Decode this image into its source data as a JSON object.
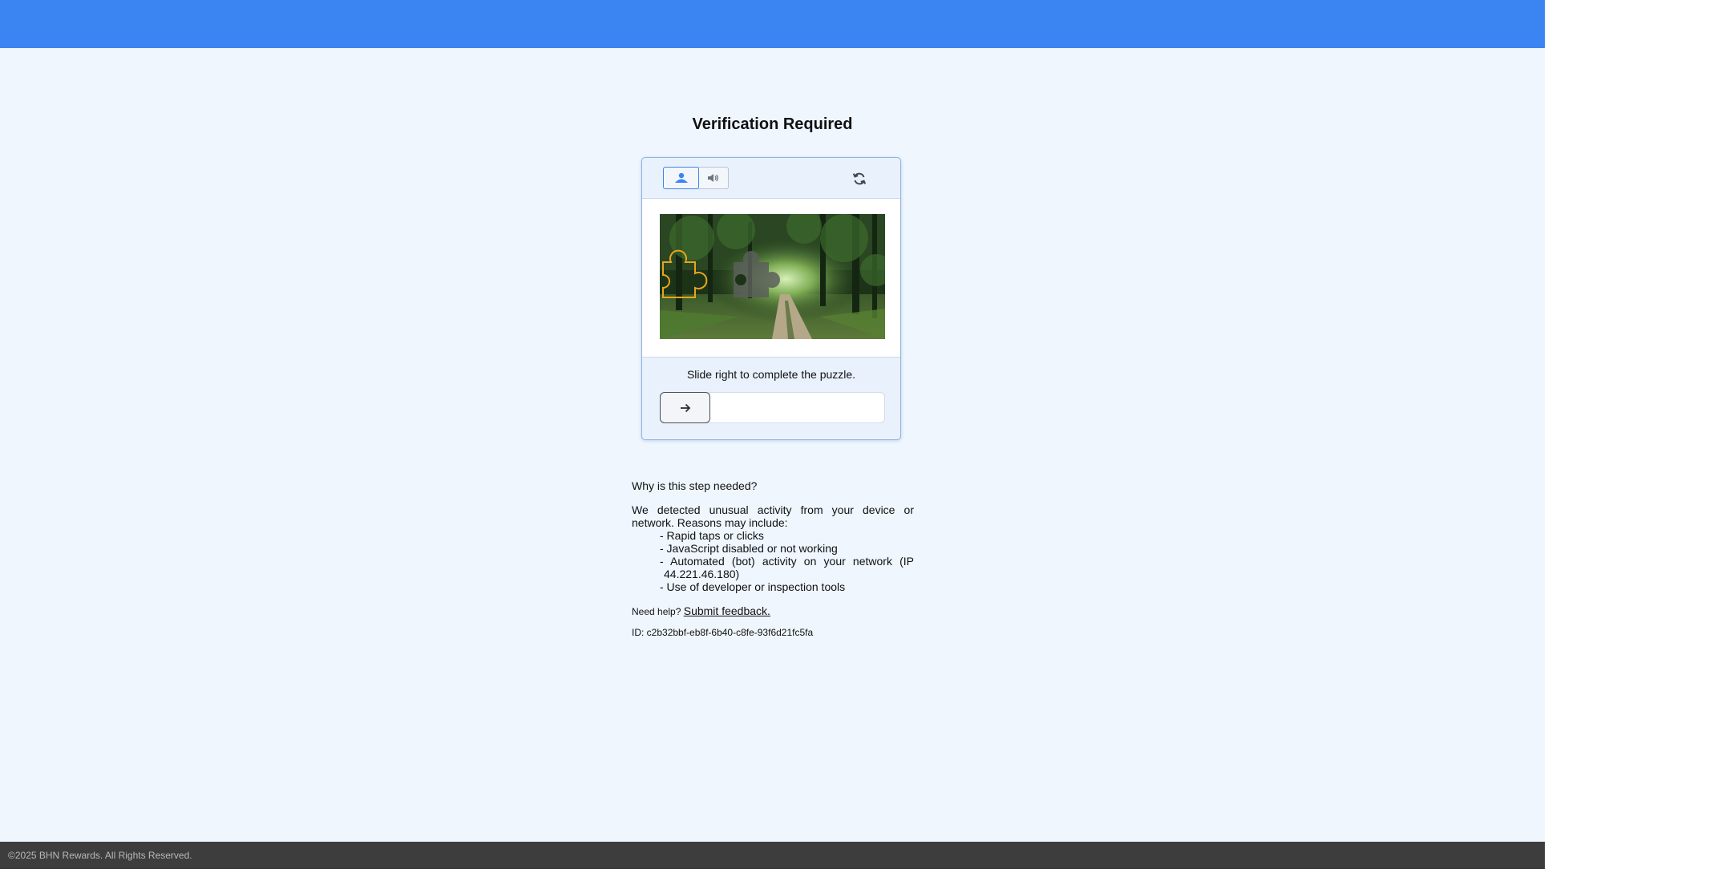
{
  "header": {
    "color": "#3a85f2"
  },
  "page": {
    "title": "Verification Required"
  },
  "captcha": {
    "modes": [
      {
        "name": "image",
        "icon": "image-person-icon",
        "selected": true
      },
      {
        "name": "audio",
        "icon": "speaker-icon",
        "selected": false
      }
    ],
    "refresh_icon": "refresh-icon",
    "puzzle_image": "forest-path-photo",
    "instruction": "Slide right to complete the puzzle.",
    "slider_icon": "arrow-right-icon",
    "slider_progress": 0
  },
  "info": {
    "title": "Why is this step needed?",
    "description": "We detected unusual activity from your device or network. Reasons may include:",
    "reasons": [
      "- Rapid taps or clicks",
      "- JavaScript disabled or not working",
      "- Automated (bot) activity on your network (IP 44.221.46.180)",
      "- Use of developer or inspection tools"
    ],
    "help_prefix": "Need help?",
    "help_link": "Submit feedback.",
    "request_id": "ID: c2b32bbf-eb8f-6b40-c8fe-93f6d21fc5fa"
  },
  "footer": {
    "copyright": "©2025 BHN Rewards. All Rights Reserved."
  }
}
